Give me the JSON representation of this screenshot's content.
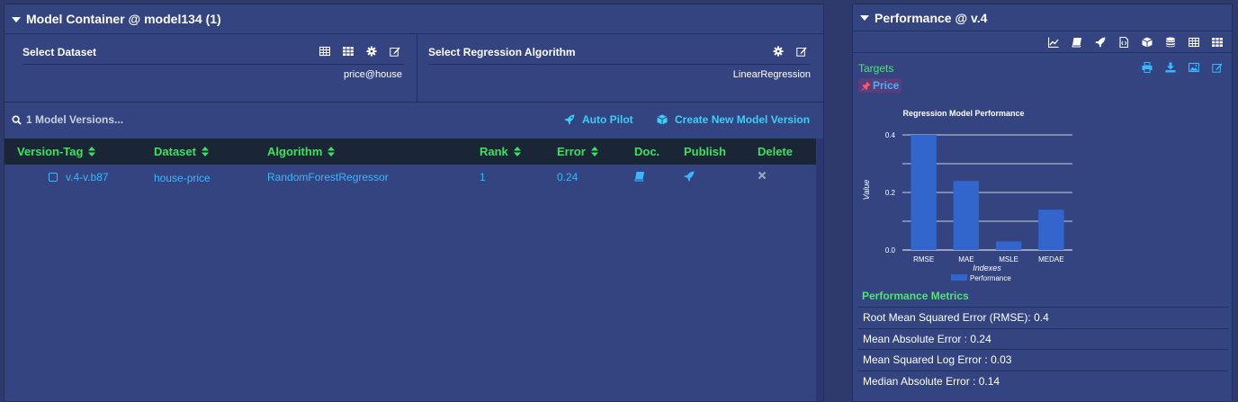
{
  "left_panel": {
    "title": "Model Container @ model134 (1)",
    "dataset_selector": {
      "title": "Select Dataset",
      "value": "price@house"
    },
    "algorithm_selector": {
      "title": "Select Regression Algorithm",
      "value": "LinearRegression"
    },
    "search": {
      "placeholder": "1 Model Versions..."
    },
    "auto_pilot_label": "Auto Pilot",
    "create_version_label": "Create New Model Version",
    "columns": [
      "Version-Tag",
      "Dataset",
      "Algorithm",
      "Rank",
      "Error",
      "Doc.",
      "Publish",
      "Delete"
    ],
    "rows": [
      {
        "version_tag": "v.4-v.b87",
        "dataset": "house-price",
        "algorithm": "RandomForestRegressor",
        "rank": "1",
        "error": "0.24"
      }
    ]
  },
  "right_panel": {
    "title": "Performance @ v.4",
    "targets_label": "Targets",
    "target_tag": "Price",
    "metrics_title": "Performance Metrics",
    "metrics": [
      "Root Mean Squared Error (RMSE): 0.4",
      "Mean Absolute Error : 0.24",
      "Mean Squared Log Error : 0.03",
      "Median Absolute Error : 0.14"
    ]
  },
  "colors": {
    "background": "#2d3a6b",
    "panel": "#334480",
    "accent_green": "#3de05f",
    "accent_cyan": "#39d0f8",
    "link_blue": "#39b8ff",
    "bar": "#3366cc",
    "table_header": "#1a2636"
  },
  "chart_data": {
    "type": "bar",
    "title": "Regression Model Performance",
    "xlabel": "Indexes",
    "ylabel": "Value",
    "categories": [
      "RMSE",
      "MAE",
      "MSLE",
      "MEDAE"
    ],
    "series": [
      {
        "name": "Performance",
        "values": [
          0.4,
          0.24,
          0.03,
          0.14
        ]
      }
    ],
    "ylim": [
      0,
      0.4
    ],
    "yticks": [
      "0.0",
      "0.2",
      "0.4"
    ],
    "grid": true,
    "legend": "bottom"
  }
}
